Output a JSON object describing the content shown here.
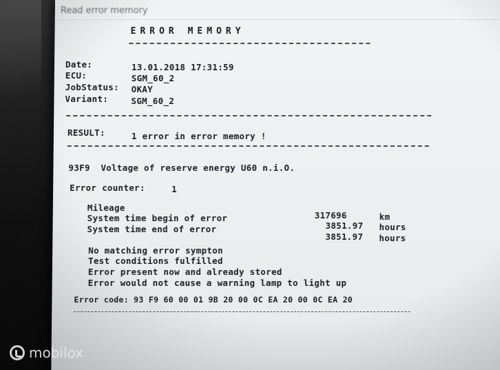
{
  "window": {
    "title": "Read error memory"
  },
  "heading": "ERROR MEMORY",
  "info": {
    "date_label": "Date:",
    "date_value": "13.01.2018 17:31:59",
    "ecu_label": "ECU:",
    "ecu_value": "SGM_60_2",
    "jobstatus_label": "JobStatus:",
    "jobstatus_value": "OKAY",
    "variant_label": "Variant:",
    "variant_value": "SGM_60_2"
  },
  "result": {
    "label": "RESULT:",
    "text": "1 error in error memory !"
  },
  "error": {
    "code_line": "93F9  Voltage of reserve energy U60 n.i.O.",
    "counter_label": "Error counter:",
    "counter_value": "1",
    "mileage_label": "Mileage",
    "mileage_value": "317696",
    "mileage_unit": "km",
    "time_begin_label": "System time begin of error",
    "time_begin_value": "3851.97",
    "time_begin_unit": "hours",
    "time_end_label": "System time end of error",
    "time_end_value": "3851.97",
    "time_end_unit": "hours",
    "notes": [
      "No matching error sympton",
      "Test conditions fulfilled",
      "Error present now and already stored",
      "Error would not cause a warning lamp to light up"
    ],
    "error_code_line": "Error code: 93 F9 60 00 01 9B 20 00 0C EA 20 00 0C EA 20"
  },
  "watermark": {
    "text": "mobilox",
    "icon": "mobilox-logo-icon"
  }
}
